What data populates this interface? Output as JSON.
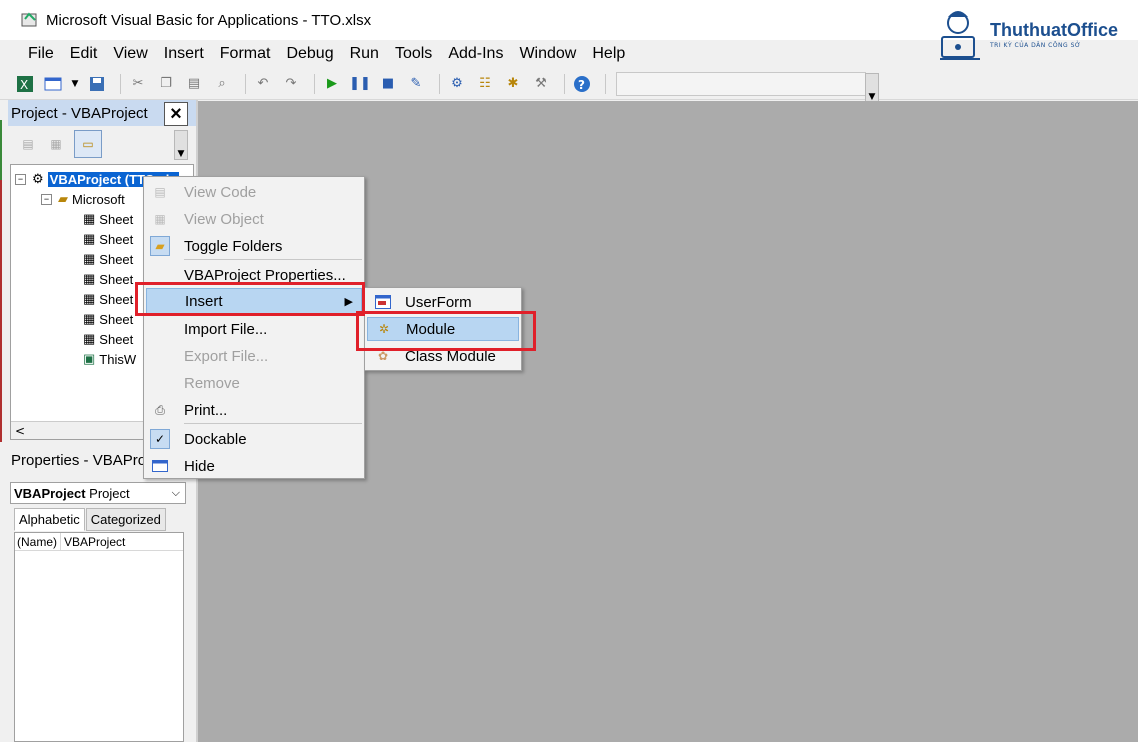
{
  "window": {
    "title": "Microsoft Visual Basic for Applications - TTO.xlsx"
  },
  "logo": {
    "brand": "ThuthuatOffice",
    "tagline": "TRI KỲ CỦA DÂN CÔNG SỞ"
  },
  "menu": [
    "File",
    "Edit",
    "View",
    "Insert",
    "Format",
    "Debug",
    "Run",
    "Tools",
    "Add-Ins",
    "Window",
    "Help"
  ],
  "toolbar": {
    "icons": [
      "excel-icon",
      "insert-userform-icon",
      "dropdown-icon",
      "save-icon",
      "cut-icon",
      "copy-icon",
      "paste-icon",
      "find-icon",
      "undo-icon",
      "redo-icon",
      "run-icon",
      "break-icon",
      "reset-icon",
      "design-mode-icon",
      "project-explorer-icon",
      "properties-icon",
      "object-browser-icon",
      "toolbox-icon",
      "help-icon"
    ]
  },
  "project": {
    "title": "Project - VBAProject",
    "close": "×",
    "root": "VBAProject (TTO.xls",
    "folder": "Microsoft",
    "sheets": [
      "Sheet",
      "Sheet",
      "Sheet",
      "Sheet",
      "Sheet",
      "Sheet",
      "Sheet"
    ],
    "workbook": "ThisW"
  },
  "properties": {
    "title": "Properties - VBAPro",
    "object_name": "VBAProject",
    "object_type": "Project",
    "tabs": [
      "Alphabetic",
      "Categorized"
    ],
    "rows": [
      {
        "key": "(Name)",
        "value": "VBAProject"
      }
    ]
  },
  "context_menu": {
    "items": [
      {
        "label": "View Code",
        "enabled": false
      },
      {
        "label": "View Object",
        "enabled": false
      },
      {
        "label": "Toggle Folders",
        "enabled": true
      },
      {
        "label": "VBAProject Properties...",
        "enabled": true
      },
      {
        "label": "Insert",
        "enabled": true,
        "highlighted": true
      },
      {
        "label": "Import File...",
        "enabled": true
      },
      {
        "label": "Export File...",
        "enabled": false
      },
      {
        "label": "Remove",
        "enabled": false
      },
      {
        "label": "Print...",
        "enabled": true
      },
      {
        "label": "Dockable",
        "enabled": true,
        "checked": true
      },
      {
        "label": "Hide",
        "enabled": true
      }
    ]
  },
  "submenu": {
    "items": [
      {
        "label": "UserForm"
      },
      {
        "label": "Module",
        "highlighted": true
      },
      {
        "label": "Class Module"
      }
    ]
  },
  "colors": {
    "highlight": "#b8d6f2",
    "annotation": "#e0202a",
    "workspace": "#ababab",
    "selection": "#0a64d2"
  }
}
